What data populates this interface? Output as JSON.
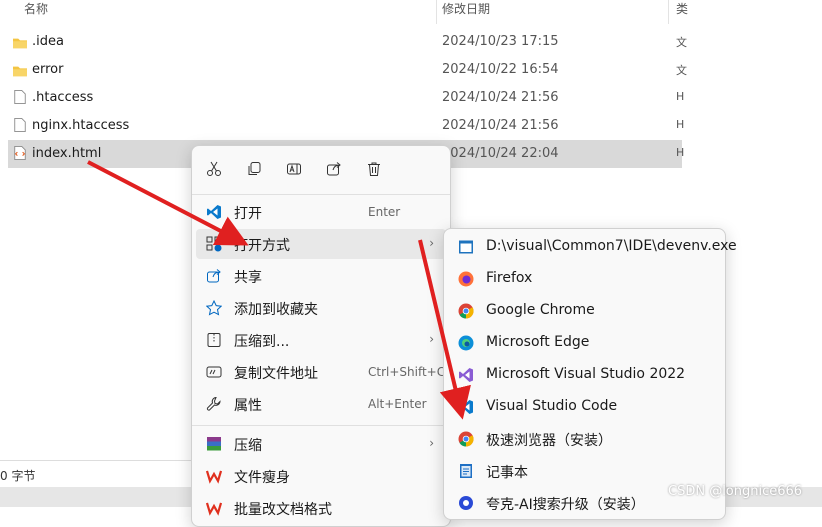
{
  "columns": {
    "name": "名称",
    "date": "修改日期",
    "type": "类"
  },
  "files": [
    {
      "name": ".idea",
      "date": "2024/10/23 17:15",
      "type": "文",
      "icon": "folder-icon"
    },
    {
      "name": "error",
      "date": "2024/10/22 16:54",
      "type": "文",
      "icon": "folder-icon"
    },
    {
      "name": ".htaccess",
      "date": "2024/10/24 21:56",
      "type": "H",
      "icon": "file-icon"
    },
    {
      "name": "nginx.htaccess",
      "date": "2024/10/24 21:56",
      "type": "H",
      "icon": "file-icon"
    },
    {
      "name": "index.html",
      "date": "2024/10/24 22:04",
      "type": "H",
      "icon": "html-file-icon"
    }
  ],
  "status": {
    "size": "0 字节"
  },
  "context_menu": {
    "toolbar": [
      "cut-icon",
      "copy-icon",
      "rename-icon",
      "share-icon",
      "delete-icon"
    ],
    "items": [
      {
        "label": "打开",
        "shortcut": "Enter",
        "icon": "vscode-icon"
      },
      {
        "label": "打开方式",
        "shortcut": "",
        "icon": "open-with-icon",
        "submenu": true
      },
      {
        "label": "共享",
        "shortcut": "",
        "icon": "share-icon"
      },
      {
        "label": "添加到收藏夹",
        "shortcut": "",
        "icon": "star-icon"
      },
      {
        "label": "压缩到...",
        "shortcut": "",
        "icon": "zip-icon",
        "submenu": true
      },
      {
        "label": "复制文件地址",
        "shortcut": "Ctrl+Shift+C",
        "icon": "path-icon"
      },
      {
        "label": "属性",
        "shortcut": "Alt+Enter",
        "icon": "wrench-icon"
      },
      {
        "label": "压缩",
        "shortcut": "",
        "icon": "winrar-icon",
        "submenu": true
      },
      {
        "label": "文件瘦身",
        "shortcut": "",
        "icon": "wps-icon"
      },
      {
        "label": "批量改文档格式",
        "shortcut": "",
        "icon": "wps-icon"
      }
    ]
  },
  "submenu": {
    "items": [
      {
        "label": "D:\\visual\\Common7\\IDE\\devenv.exe",
        "icon": "exe-icon"
      },
      {
        "label": "Firefox",
        "icon": "firefox-icon"
      },
      {
        "label": "Google Chrome",
        "icon": "chrome-icon"
      },
      {
        "label": "Microsoft Edge",
        "icon": "edge-icon"
      },
      {
        "label": "Microsoft Visual Studio 2022",
        "icon": "visual-studio-icon"
      },
      {
        "label": "Visual Studio Code",
        "icon": "vscode-icon"
      },
      {
        "label": "极速浏览器（安装）",
        "icon": "chrome-icon"
      },
      {
        "label": "记事本",
        "icon": "notepad-icon"
      },
      {
        "label": "夸克-AI搜索升级（安装）",
        "icon": "quark-icon"
      }
    ]
  },
  "watermark": "CSDN @longnice666",
  "colors": {
    "selection": "#d9d9d9",
    "arrow": "#e02020",
    "accent": "#0067c0"
  }
}
